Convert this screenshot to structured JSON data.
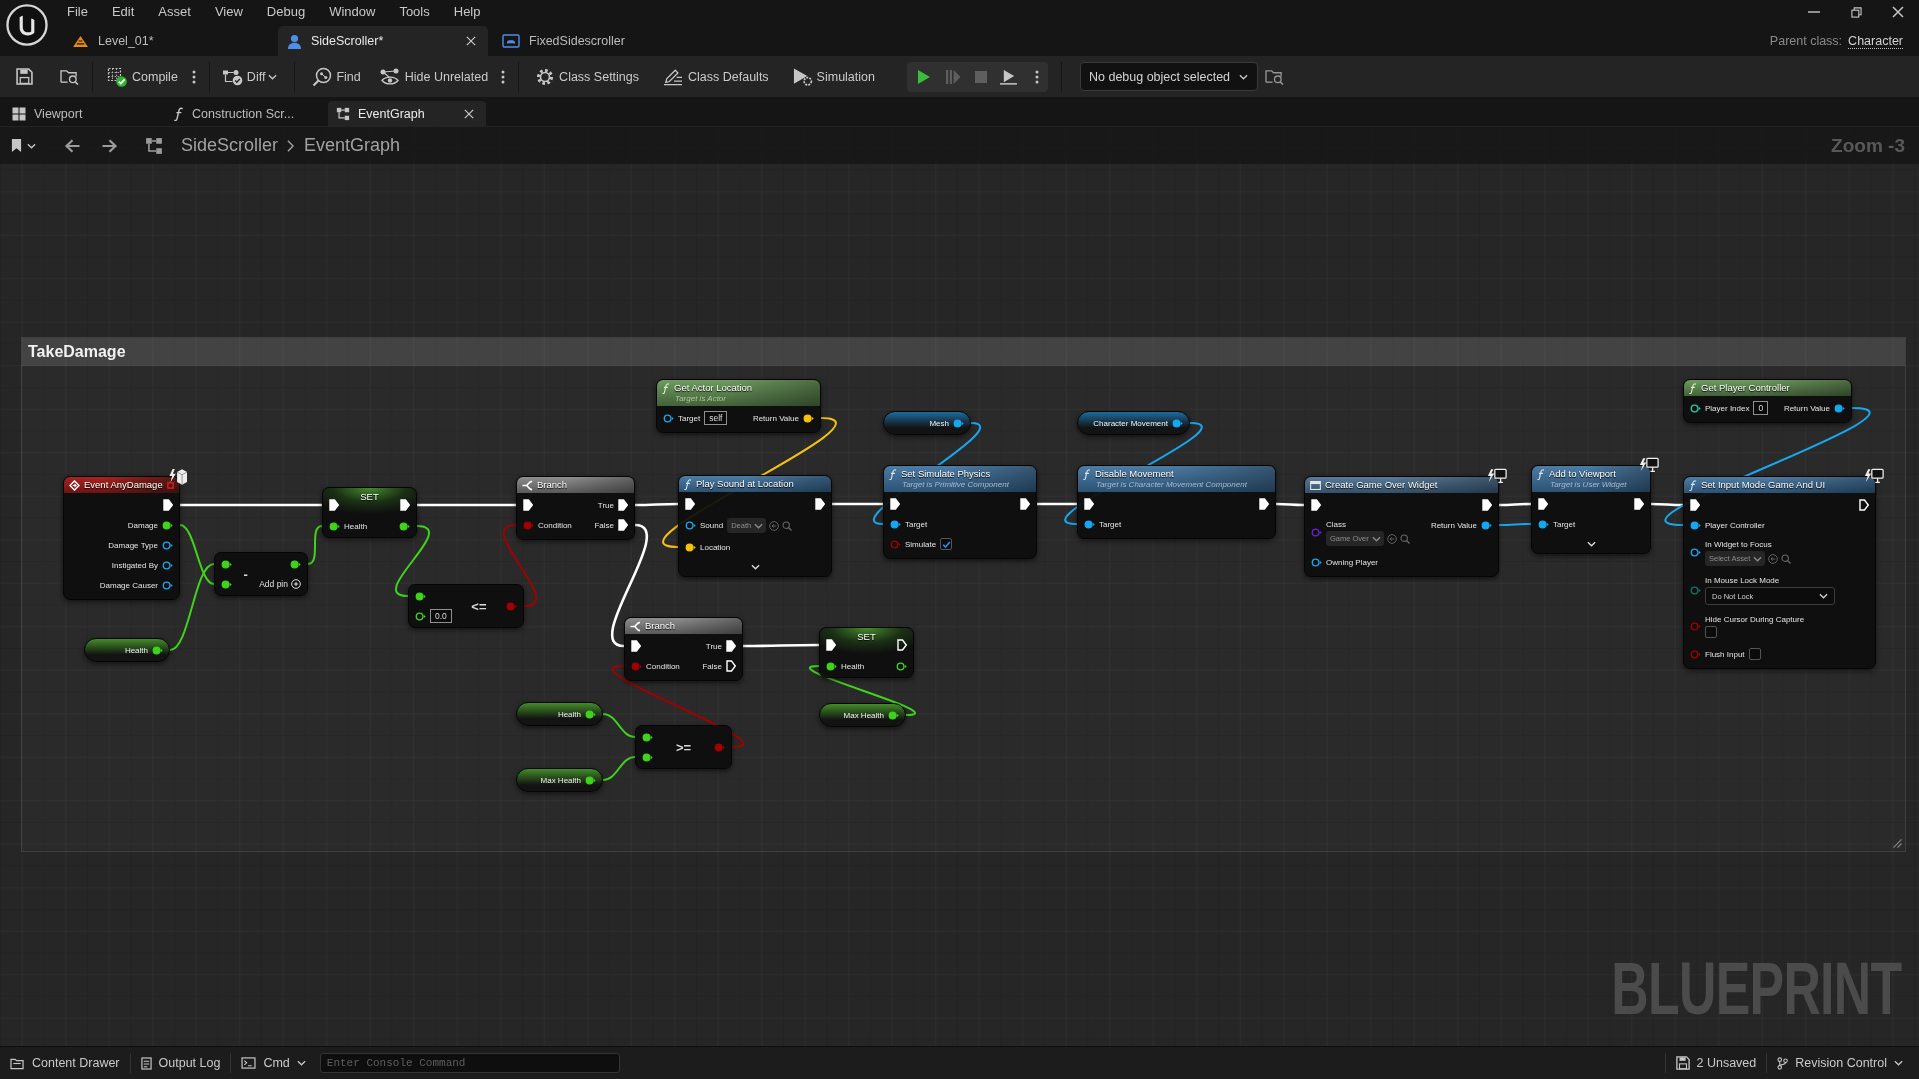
{
  "menu": [
    "File",
    "Edit",
    "Asset",
    "View",
    "Debug",
    "Window",
    "Tools",
    "Help"
  ],
  "document_tabs": [
    {
      "label": "Level_01*",
      "kind": "level",
      "selected": false
    },
    {
      "label": "SideScroller*",
      "kind": "character",
      "selected": true
    },
    {
      "label": "FixedSidescroller",
      "kind": "widget",
      "selected": false
    }
  ],
  "parent_class": {
    "label": "Parent class:",
    "value": "Character"
  },
  "toolbar": [
    {
      "kind": "plain",
      "items": [
        {
          "kind": "save"
        },
        {
          "kind": "browse"
        }
      ]
    },
    {
      "kind": "plain",
      "items": [
        {
          "kind": "compile",
          "label": "Compile",
          "compiled": true
        },
        {
          "kind": "more"
        }
      ]
    },
    {
      "kind": "plain",
      "items": [
        {
          "kind": "diff",
          "label": "Diff",
          "dropdown": true
        }
      ]
    },
    {
      "kind": "plain",
      "items": [
        {
          "kind": "find",
          "label": "Find"
        },
        {
          "kind": "hide-unrelated",
          "label": "Hide Unrelated"
        },
        {
          "kind": "more"
        }
      ]
    },
    {
      "kind": "plain",
      "items": [
        {
          "kind": "class-settings",
          "label": "Class Settings"
        },
        {
          "kind": "class-defaults",
          "label": "Class Defaults"
        },
        {
          "kind": "simulation",
          "label": "Simulation"
        }
      ]
    },
    {
      "kind": "boxed",
      "items": [
        {
          "kind": "play",
          "disabled": false
        },
        {
          "kind": "advance",
          "disabled": true
        },
        {
          "kind": "stop",
          "disabled": true
        },
        {
          "kind": "eject",
          "disabled": false
        },
        {
          "kind": "more",
          "disabled": false
        }
      ]
    },
    {
      "kind": "plain",
      "items": [
        {
          "kind": "debug-filter",
          "label": "No debug object selected",
          "dropdown": true
        },
        {
          "kind": "debug-browse"
        }
      ]
    }
  ],
  "editor_tabs": [
    {
      "label": "Viewport",
      "kind": "viewport",
      "selected": false
    },
    {
      "label": "Construction Scr...",
      "kind": "function",
      "selected": false
    },
    {
      "label": "EventGraph",
      "kind": "graph",
      "selected": true
    }
  ],
  "breadcrumb": [
    "SideScroller",
    "EventGraph"
  ],
  "zoom_label": "Zoom -3",
  "comment": {
    "title": "TakeDamage"
  },
  "nodes": [
    {
      "kind": "event",
      "title": "Event AnyDamage",
      "net_badge": true,
      "advanced": false,
      "header_pin": {
        "kind": "delegate",
        "connected": false
      },
      "outputs": [
        {
          "kind": "exec",
          "connected": true
        },
        {
          "kind": "float",
          "label": "Damage",
          "connected": true
        },
        {
          "kind": "object",
          "label": "Damage Type",
          "connected": false
        },
        {
          "kind": "object",
          "label": "Instigated By",
          "connected": false
        },
        {
          "kind": "object",
          "label": "Damage Causer",
          "connected": false
        }
      ]
    },
    {
      "kind": "set",
      "title": "SET",
      "net_badge": false,
      "advanced": false,
      "inputs": [
        {
          "kind": "exec",
          "connected": true
        },
        {
          "kind": "float",
          "label": "Health",
          "connected": true
        }
      ],
      "outputs": [
        {
          "kind": "exec",
          "connected": true
        },
        {
          "kind": "float",
          "connected": true
        }
      ]
    },
    {
      "kind": "operator",
      "symbol": "-",
      "add_pin": "Add pin",
      "net_badge": false,
      "advanced": false,
      "inputs": [
        {
          "kind": "float",
          "connected": true
        },
        {
          "kind": "float",
          "connected": true
        }
      ],
      "outputs": [
        {
          "kind": "float",
          "connected": true
        }
      ]
    },
    {
      "kind": "getter",
      "net_badge": false,
      "advanced": false,
      "outputs": [
        {
          "kind": "float",
          "label": "Health",
          "connected": true
        }
      ]
    },
    {
      "kind": "operator",
      "symbol": "<=",
      "net_badge": false,
      "advanced": false,
      "inputs": [
        {
          "kind": "float",
          "connected": true
        },
        {
          "kind": "float",
          "connected": false,
          "value": "0.0"
        }
      ],
      "outputs": [
        {
          "kind": "bool",
          "connected": true
        }
      ]
    },
    {
      "kind": "branch",
      "title": "Branch",
      "net_badge": false,
      "advanced": false,
      "inputs": [
        {
          "kind": "exec",
          "connected": true
        },
        {
          "kind": "bool",
          "label": "Condition",
          "connected": true
        }
      ],
      "outputs": [
        {
          "kind": "exec",
          "label": "True",
          "connected": true
        },
        {
          "kind": "exec",
          "label": "False",
          "connected": true
        }
      ]
    },
    {
      "kind": "pure",
      "title": "Get Actor Location",
      "subtitle": "Target is Actor",
      "net_badge": false,
      "advanced": false,
      "inputs": [
        {
          "kind": "object",
          "label": "Target",
          "connected": false,
          "value": "self"
        }
      ],
      "outputs": [
        {
          "kind": "vector",
          "label": "Return Value",
          "connected": true
        }
      ]
    },
    {
      "kind": "call",
      "title": "Play Sound at Location",
      "net_badge": false,
      "advanced": true,
      "inputs": [
        {
          "kind": "exec",
          "connected": true
        },
        {
          "kind": "object",
          "label": "Sound",
          "connected": false,
          "asset": "Death"
        },
        {
          "kind": "vector",
          "label": "Location",
          "connected": true
        }
      ],
      "outputs": [
        {
          "kind": "exec",
          "connected": true
        }
      ]
    },
    {
      "kind": "branch",
      "title": "Branch",
      "net_badge": false,
      "advanced": false,
      "inputs": [
        {
          "kind": "exec",
          "connected": true
        },
        {
          "kind": "bool",
          "label": "Condition",
          "connected": true
        }
      ],
      "outputs": [
        {
          "kind": "exec",
          "label": "True",
          "connected": true
        },
        {
          "kind": "exec",
          "label": "False",
          "connected": false
        }
      ]
    },
    {
      "kind": "getter",
      "net_badge": false,
      "advanced": false,
      "outputs": [
        {
          "kind": "float",
          "label": "Health",
          "connected": true
        }
      ]
    },
    {
      "kind": "getter",
      "net_badge": false,
      "advanced": false,
      "outputs": [
        {
          "kind": "float",
          "label": "Max Health",
          "connected": true
        }
      ]
    },
    {
      "kind": "operator",
      "symbol": ">=",
      "net_badge": false,
      "advanced": false,
      "inputs": [
        {
          "kind": "float",
          "connected": true
        },
        {
          "kind": "float",
          "connected": true
        }
      ],
      "outputs": [
        {
          "kind": "bool",
          "connected": true
        }
      ]
    },
    {
      "kind": "set",
      "title": "SET",
      "net_badge": false,
      "advanced": false,
      "inputs": [
        {
          "kind": "exec",
          "connected": true
        },
        {
          "kind": "float",
          "label": "Health",
          "connected": true
        }
      ],
      "outputs": [
        {
          "kind": "exec",
          "connected": false
        },
        {
          "kind": "float",
          "connected": false
        }
      ]
    },
    {
      "kind": "getter",
      "net_badge": false,
      "advanced": false,
      "outputs": [
        {
          "kind": "float",
          "label": "Max Health",
          "connected": true
        }
      ]
    },
    {
      "kind": "getter",
      "net_badge": false,
      "advanced": false,
      "outputs": [
        {
          "kind": "object",
          "label": "Mesh",
          "connected": true
        }
      ]
    },
    {
      "kind": "call",
      "title": "Set Simulate Physics",
      "subtitle": "Target is Primitive Component",
      "net_badge": false,
      "advanced": false,
      "inputs": [
        {
          "kind": "exec",
          "connected": true
        },
        {
          "kind": "object",
          "label": "Target",
          "connected": true
        },
        {
          "kind": "bool",
          "label": "Simulate",
          "connected": false,
          "checked": true
        }
      ],
      "outputs": [
        {
          "kind": "exec",
          "connected": true
        }
      ]
    },
    {
      "kind": "getter",
      "net_badge": false,
      "advanced": false,
      "outputs": [
        {
          "kind": "object",
          "label": "Character Movement",
          "connected": true
        }
      ]
    },
    {
      "kind": "call",
      "title": "Disable Movement",
      "subtitle": "Target is Character Movement Component",
      "net_badge": false,
      "advanced": false,
      "inputs": [
        {
          "kind": "exec",
          "connected": true
        },
        {
          "kind": "object",
          "label": "Target",
          "connected": true
        }
      ],
      "outputs": [
        {
          "kind": "exec",
          "connected": true
        }
      ]
    },
    {
      "kind": "widget",
      "title": "Create Game Over Widget",
      "net_badge": true,
      "advanced": false,
      "inputs": [
        {
          "kind": "exec",
          "connected": true
        },
        {
          "kind": "class",
          "label": "Class",
          "connected": false,
          "asset": "Game Over"
        },
        {
          "kind": "object",
          "label": "Owning Player",
          "connected": false
        }
      ],
      "outputs": [
        {
          "kind": "exec",
          "connected": true
        },
        {
          "kind": "object",
          "label": "Return Value",
          "connected": true
        }
      ]
    },
    {
      "kind": "call",
      "title": "Add to Viewport",
      "subtitle": "Target is User Widget",
      "net_badge": true,
      "advanced": true,
      "inputs": [
        {
          "kind": "exec",
          "connected": true
        },
        {
          "kind": "object",
          "label": "Target",
          "connected": true
        }
      ],
      "outputs": [
        {
          "kind": "exec",
          "connected": true
        }
      ]
    },
    {
      "kind": "pure",
      "title": "Get Player Controller",
      "net_badge": false,
      "advanced": false,
      "inputs": [
        {
          "kind": "int",
          "label": "Player Index",
          "connected": false,
          "value": "0"
        }
      ],
      "outputs": [
        {
          "kind": "object",
          "label": "Return Value",
          "connected": true
        }
      ]
    },
    {
      "kind": "call",
      "title": "Set Input Mode Game And UI",
      "net_badge": true,
      "advanced": false,
      "inputs": [
        {
          "kind": "exec",
          "connected": true
        },
        {
          "kind": "object",
          "label": "Player Controller",
          "connected": true
        },
        {
          "kind": "object",
          "label": "In Widget to Focus",
          "connected": false,
          "asset": "Select Asset"
        },
        {
          "kind": "enum",
          "label": "In Mouse Lock Mode",
          "connected": false,
          "option": "Do Not Lock"
        },
        {
          "kind": "bool",
          "label": "Hide Cursor During Capture",
          "connected": false,
          "checked": false
        },
        {
          "kind": "bool",
          "label": "Flush Input",
          "connected": false,
          "checked": false
        }
      ],
      "outputs": [
        {
          "kind": "exec",
          "connected": false
        }
      ]
    }
  ],
  "graph_type_label": "BLUEPRINT",
  "status_bar": {
    "left": [
      {
        "kind": "drawer",
        "label": "Content Drawer"
      },
      {
        "kind": "log",
        "label": "Output Log"
      },
      {
        "kind": "cmd",
        "label": "Cmd",
        "dropdown": true
      }
    ],
    "console": {
      "placeholder": "Enter Console Command"
    },
    "right": [
      {
        "kind": "unsaved",
        "label": "2 Unsaved"
      },
      {
        "kind": "revision",
        "label": "Revision Control",
        "dropdown": true
      }
    ]
  }
}
